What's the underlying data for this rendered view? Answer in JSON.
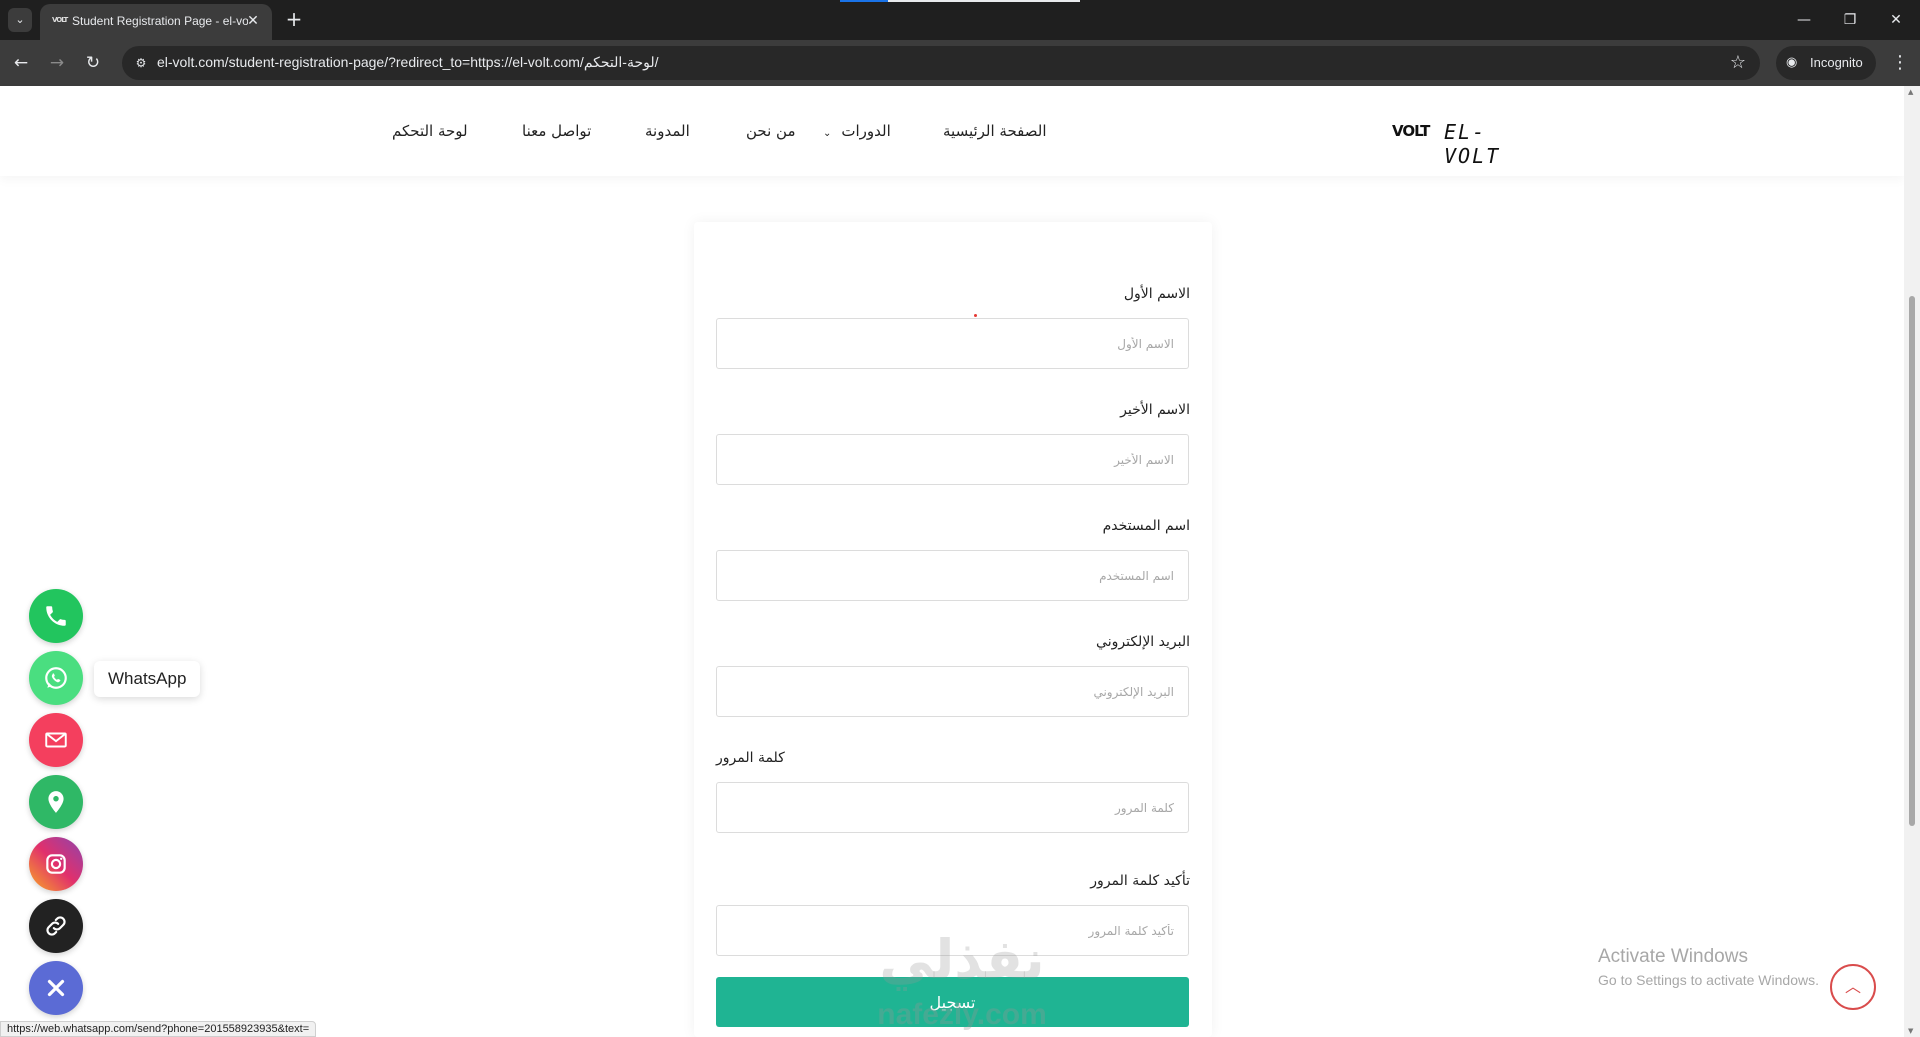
{
  "browser": {
    "tab_title": "Student Registration Page - el-volt",
    "favicon_text": "VOLT",
    "url": "el-volt.com/student-registration-page/?redirect_to=https://el-volt.com/لوحة-التحكم/",
    "incognito_label": "Incognito"
  },
  "site": {
    "logo_mark": "VOLT",
    "logo_text": "EL-VOLT",
    "nav": {
      "home": "الصفحة الرئيسية",
      "courses": "الدورات",
      "about": "من نحن",
      "blog": "المدونة",
      "contact": "تواصل معنا",
      "dashboard": "لوحة التحكم"
    }
  },
  "form": {
    "first_name": {
      "label": "الاسم الأول",
      "placeholder": "الاسم الأول"
    },
    "last_name": {
      "label": "الاسم الأخير",
      "placeholder": "الاسم الأخير"
    },
    "username": {
      "label": "اسم المستخدم",
      "placeholder": "اسم المستخدم"
    },
    "email": {
      "label": "البريد الإلكتروني",
      "placeholder": "البريد الإلكتروني"
    },
    "password": {
      "label": "كلمة المرور",
      "placeholder": "كلمة المرور"
    },
    "confirm_password": {
      "label": "تأكيد كلمة المرور",
      "placeholder": "تأكيد كلمة المرور"
    },
    "submit_label": "تسجيل"
  },
  "contact_buttons": {
    "whatsapp_tooltip": "WhatsApp",
    "colors": {
      "phone": "#22c55e",
      "whatsapp": "#4ade80",
      "email": "#f43f5e",
      "location": "#2fb866",
      "instagram": "#e1306c",
      "link": "#222222",
      "close": "#5b6bd5"
    }
  },
  "status_bar_url": "https://web.whatsapp.com/send?phone=201558923935&text=",
  "watermark": {
    "arabic": "نفذلي",
    "latin": "nafezly.com"
  },
  "windows_activation": {
    "title": "Activate Windows",
    "subtitle": "Go to Settings to activate Windows."
  },
  "theme": {
    "accent": "#1fb493"
  }
}
